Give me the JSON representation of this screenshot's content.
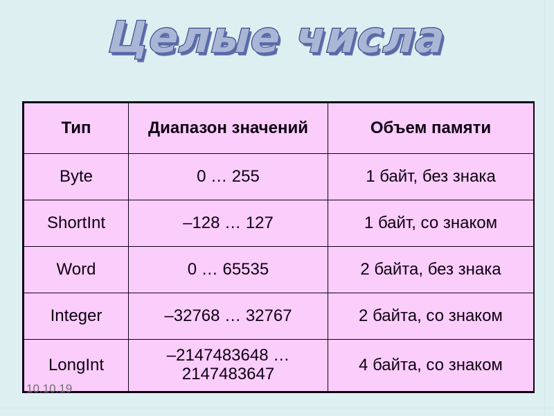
{
  "slide": {
    "title": "Целые числа",
    "background_color": "#deeff2",
    "date_stamp": "10.10.19"
  },
  "table": {
    "accent_color": "#fbcdfa",
    "border_color": "#100018",
    "headers": {
      "type": "Тип",
      "range": "Диапазон значений",
      "memory": "Объем памяти"
    },
    "rows": [
      {
        "type": "Byte",
        "range_line1": "0 … 255",
        "range_line2": "",
        "memory": "1 байт, без знака"
      },
      {
        "type": "ShortInt",
        "range_line1": "–128 … 127",
        "range_line2": "",
        "memory": "1 байт, со знаком"
      },
      {
        "type": "Word",
        "range_line1": "0 … 65535",
        "range_line2": "",
        "memory": "2 байта, без знака"
      },
      {
        "type": "Integer",
        "range_line1": "–32768 … 32767",
        "range_line2": "",
        "memory": "2 байта, со знаком"
      },
      {
        "type": "LongInt",
        "range_line1": "–2147483648 …",
        "range_line2": "2147483647",
        "memory": "4 байта, со знаком"
      }
    ]
  }
}
